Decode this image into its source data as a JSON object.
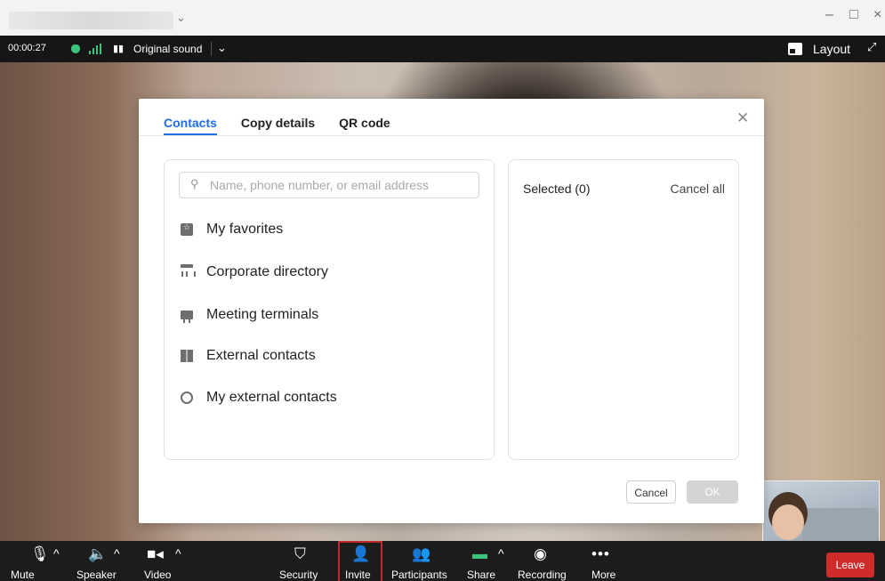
{
  "titlebar": {
    "chevron": "⌄",
    "controls": [
      "–",
      "□",
      "×"
    ]
  },
  "meeting_bar": {
    "timer": "00:00:27",
    "original_sound_label": "Original sound",
    "layout_label": "Layout",
    "security_status_color": "#3cc47a"
  },
  "dialog": {
    "tabs": [
      {
        "label": "Contacts",
        "active": true
      },
      {
        "label": "Copy details",
        "active": false
      },
      {
        "label": "QR code",
        "active": false
      }
    ],
    "search_placeholder": "Name, phone number, or email address",
    "categories": [
      {
        "label": "My favorites",
        "icon": "favorites-folder-icon"
      },
      {
        "label": "Corporate directory",
        "icon": "org-chart-icon"
      },
      {
        "label": "Meeting terminals",
        "icon": "terminal-icon"
      },
      {
        "label": "External contacts",
        "icon": "building-icon"
      },
      {
        "label": "My external contacts",
        "icon": "external-network-icon"
      }
    ],
    "selected_label": "Selected (0)",
    "cancel_all_label": "Cancel all",
    "cancel_label": "Cancel",
    "ok_label": "OK",
    "accent_color": "#1f6fe5"
  },
  "toolbar": {
    "items": [
      {
        "label": "Mute",
        "icon": "microphone-icon"
      },
      {
        "label": "Speaker",
        "icon": "speaker-icon"
      },
      {
        "label": "Video",
        "icon": "video-camera-icon"
      },
      {
        "label": "Security",
        "icon": "shield-icon"
      },
      {
        "label": "Invite",
        "icon": "add-person-icon"
      },
      {
        "label": "Participants",
        "icon": "participants-icon"
      },
      {
        "label": "Share",
        "icon": "share-screen-icon"
      },
      {
        "label": "Recording",
        "icon": "record-icon"
      },
      {
        "label": "More",
        "icon": "more-dots-icon"
      }
    ],
    "leave_label": "Leave",
    "leave_color": "#cf2b2b",
    "highlight_color": "#c0282e"
  }
}
